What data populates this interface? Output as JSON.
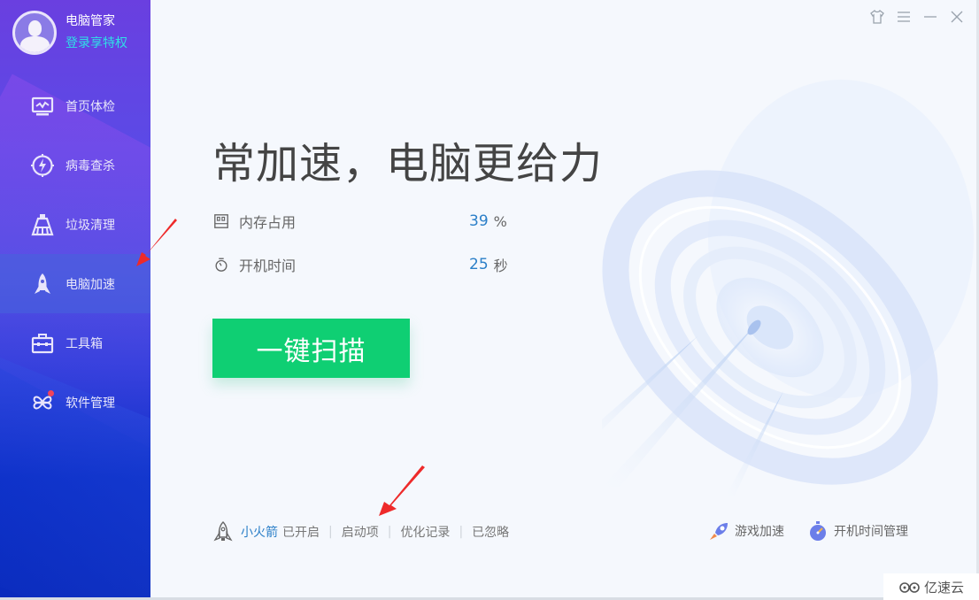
{
  "profile": {
    "app_name": "电脑管家",
    "login_link": "登录享特权"
  },
  "sidebar": {
    "items": [
      {
        "label": "首页体检",
        "icon": "monitor-pulse-icon",
        "active": false
      },
      {
        "label": "病毒查杀",
        "icon": "lightning-shield-icon",
        "active": false
      },
      {
        "label": "垃圾清理",
        "icon": "broom-icon",
        "active": false
      },
      {
        "label": "电脑加速",
        "icon": "rocket-icon",
        "active": true
      },
      {
        "label": "工具箱",
        "icon": "toolbox-icon",
        "active": false
      },
      {
        "label": "软件管理",
        "icon": "software-clover-icon",
        "active": false,
        "badge": true
      }
    ]
  },
  "window_controls": {
    "skin": "tshirt-icon",
    "menu": "menu-icon",
    "minimize": "minimize-icon",
    "close": "close-icon"
  },
  "main": {
    "headline": "常加速，电脑更给力",
    "stats": [
      {
        "label": "内存占用",
        "value": "39",
        "unit": "%",
        "icon": "memory-icon"
      },
      {
        "label": "开机时间",
        "value": "25",
        "unit": "秒",
        "icon": "stopwatch-icon"
      }
    ],
    "scan_button": "一键扫描"
  },
  "footer": {
    "rocket_name": "小火箭",
    "rocket_status": "已开启",
    "links": [
      "启动项",
      "优化记录",
      "已忽略"
    ],
    "right_links": [
      {
        "label": "游戏加速",
        "icon": "game-boost-icon"
      },
      {
        "label": "开机时间管理",
        "icon": "boot-timer-icon"
      }
    ]
  },
  "colors": {
    "accent_blue": "#2b7fc8",
    "scan_green": "#0fcf73",
    "login_cyan": "#2fe0e6",
    "badge_red": "#f0435a",
    "annotation_red": "#ee2a2a"
  },
  "watermark": "亿速云"
}
